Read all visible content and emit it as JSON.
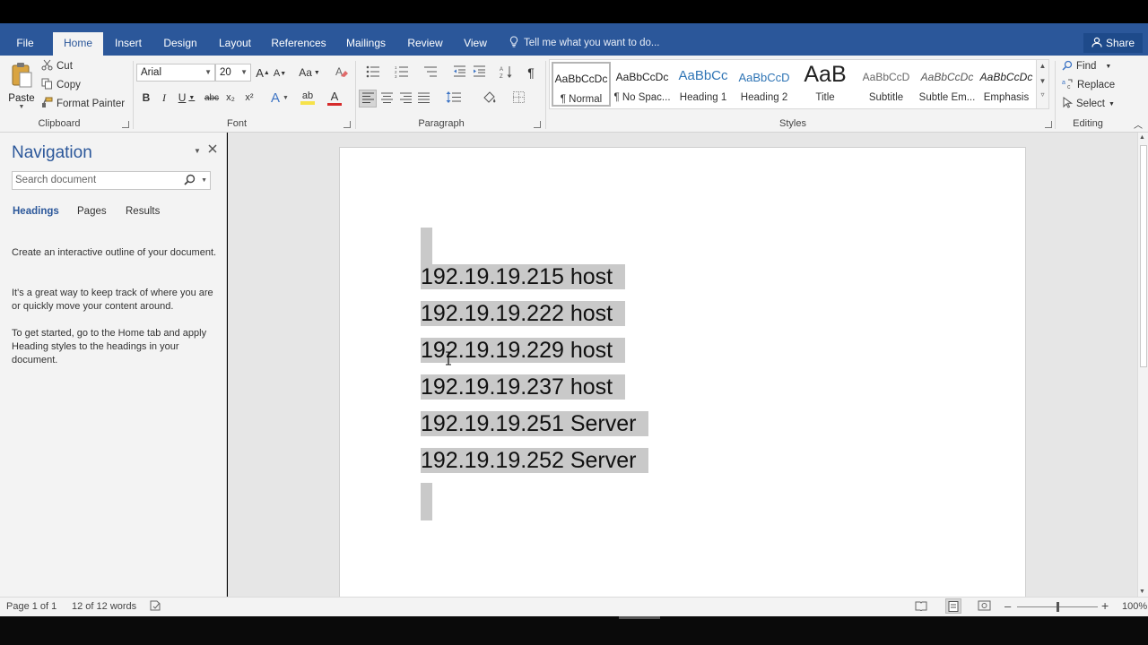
{
  "ribbon_tabs": [
    {
      "label": "File",
      "name": "tab-file"
    },
    {
      "label": "Home",
      "name": "tab-home"
    },
    {
      "label": "Insert",
      "name": "tab-insert"
    },
    {
      "label": "Design",
      "name": "tab-design"
    },
    {
      "label": "Layout",
      "name": "tab-layout"
    },
    {
      "label": "References",
      "name": "tab-references"
    },
    {
      "label": "Mailings",
      "name": "tab-mailings"
    },
    {
      "label": "Review",
      "name": "tab-review"
    },
    {
      "label": "View",
      "name": "tab-view"
    }
  ],
  "active_tab": "Home",
  "tell_me": "Tell me what you want to do...",
  "share_label": "Share",
  "clipboard": {
    "paste": "Paste",
    "cut": "Cut",
    "copy": "Copy",
    "format_painter": "Format Painter",
    "group": "Clipboard"
  },
  "font": {
    "family": "Arial",
    "size": "20",
    "group": "Font",
    "grow": "A",
    "shrink": "A",
    "change_case": "Aa",
    "bold": "B",
    "italic": "I",
    "underline": "U",
    "strike": "abc",
    "subscript": "x₂",
    "superscript": "x²",
    "text_effects": "A",
    "highlight": "ab",
    "font_color": "A"
  },
  "paragraph": {
    "group": "Paragraph"
  },
  "styles": {
    "group": "Styles",
    "items": [
      {
        "preview": "AaBbCcDc",
        "name": "¶ Normal"
      },
      {
        "preview": "AaBbCcDc",
        "name": "¶ No Spac..."
      },
      {
        "preview": "AaBbCc",
        "name": "Heading 1"
      },
      {
        "preview": "AaBbCcD",
        "name": "Heading 2"
      },
      {
        "preview": "AaB",
        "name": "Title"
      },
      {
        "preview": "AaBbCcD",
        "name": "Subtitle"
      },
      {
        "preview": "AaBbCcDc",
        "name": "Subtle Em..."
      },
      {
        "preview": "AaBbCcDc",
        "name": "Emphasis"
      }
    ]
  },
  "editing": {
    "find": "Find",
    "replace": "Replace",
    "select": "Select",
    "group": "Editing"
  },
  "navigation": {
    "title": "Navigation",
    "search_placeholder": "Search document",
    "tabs": [
      "Headings",
      "Pages",
      "Results"
    ],
    "active_tab": "Headings",
    "paragraphs": [
      "Create an interactive outline of your document.",
      "It's a great way to keep track of where you are or quickly move your content around.",
      "To get started, go to the Home tab and apply Heading styles to the headings in your document."
    ]
  },
  "document": {
    "lines": [
      "192.19.19.215 host",
      "192.19.19.222 host",
      "192.19.19.229 host",
      "192.19.19.237 host",
      "192.19.19.251 Server",
      "192.19.19.252 Server"
    ]
  },
  "status": {
    "page": "Page 1 of 1",
    "words": "12 of 12 words",
    "zoom": "100%",
    "zoom_level": 1.0
  },
  "colors": {
    "accent": "#2b579a",
    "ribbon_bg": "#f3f3f3",
    "selection": "#c9c9c9"
  }
}
